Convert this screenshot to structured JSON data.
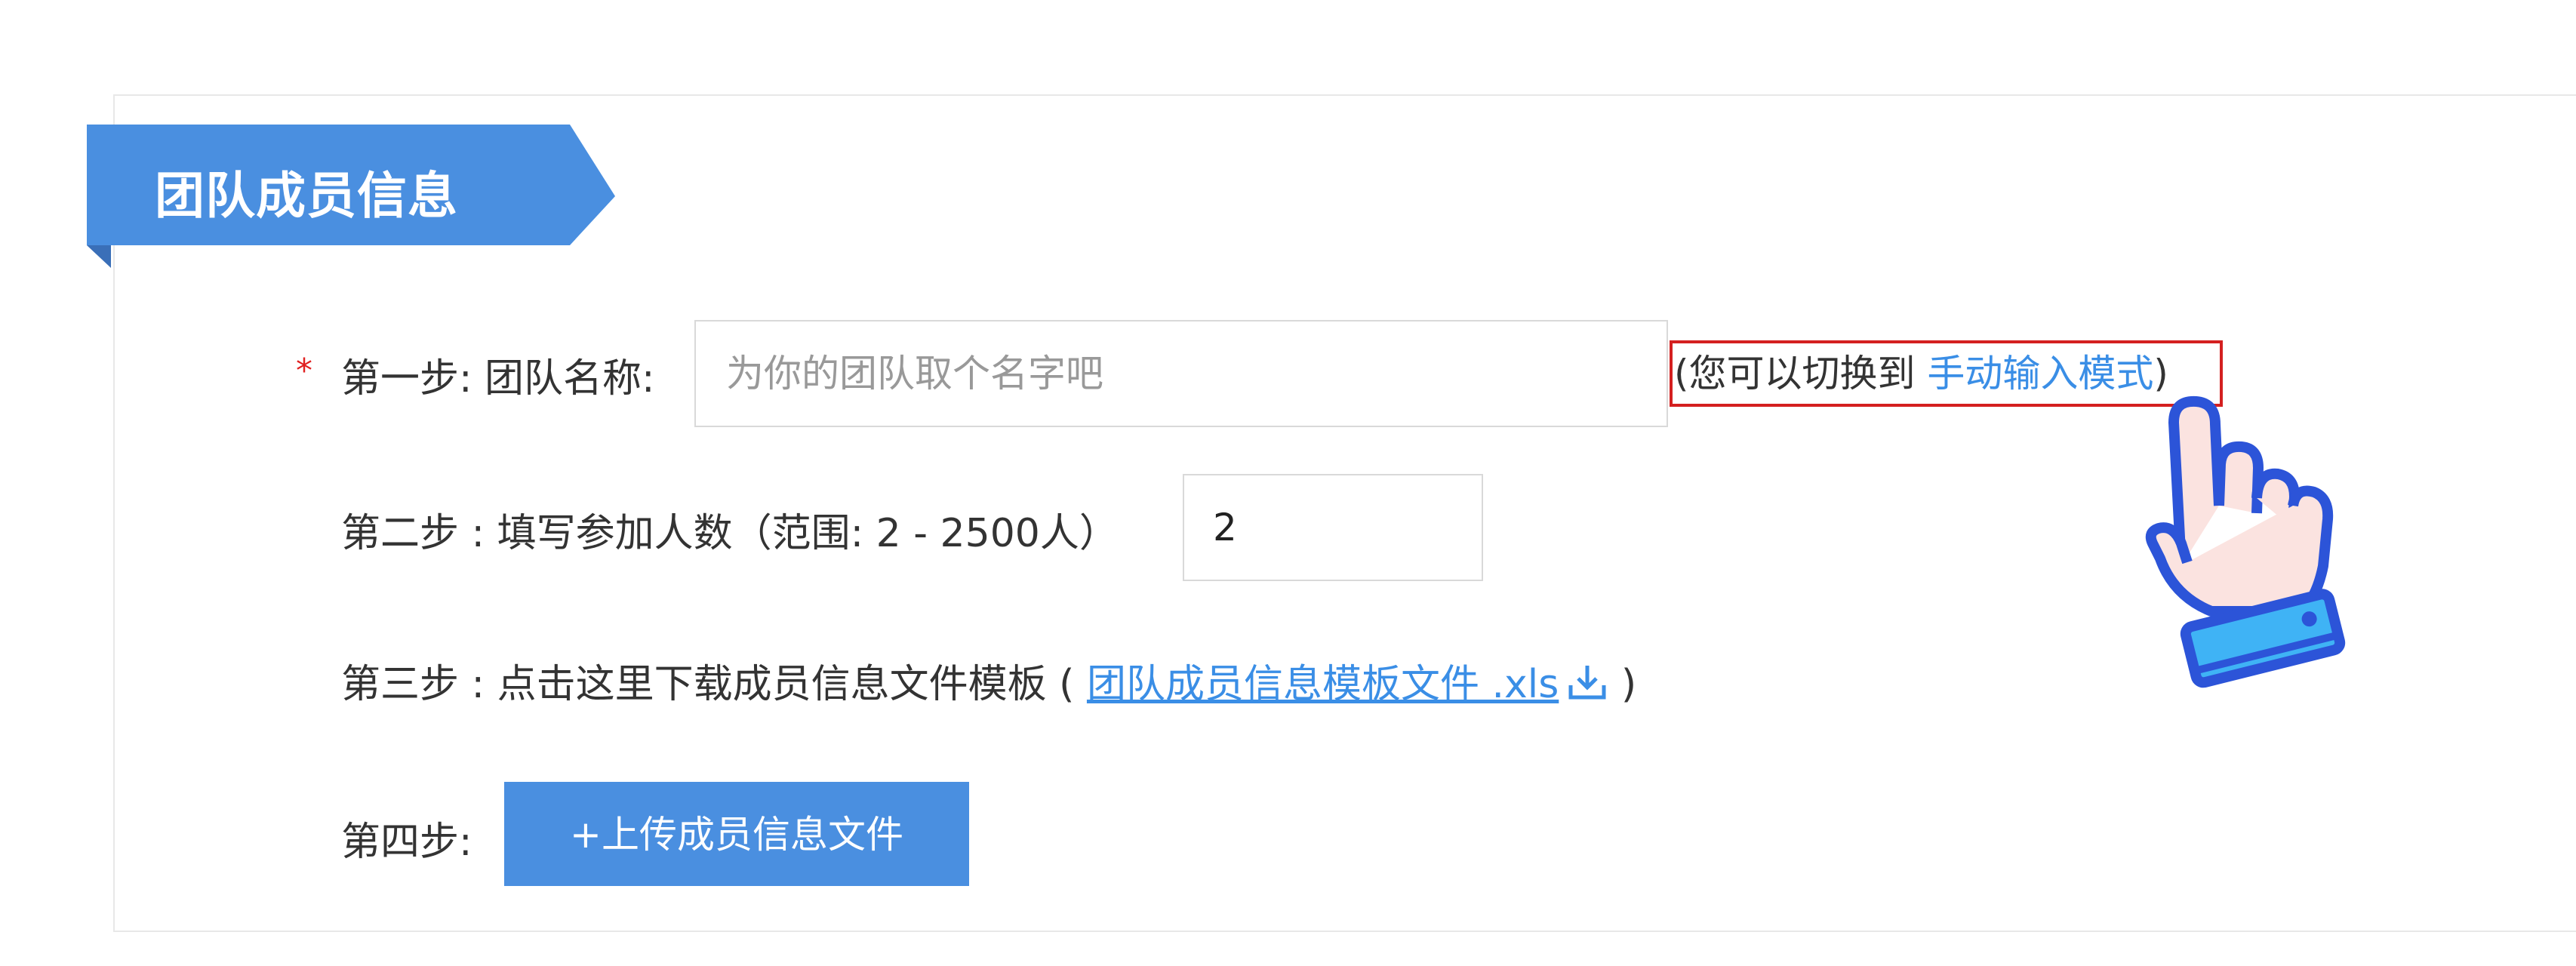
{
  "section": {
    "title": "团队成员信息"
  },
  "step1": {
    "label": "第一步: 团队名称:",
    "required_mark": "*",
    "input_placeholder": "为你的团队取个名字吧",
    "input_value": "",
    "hint_prefix": "(您可以切换到 ",
    "hint_link": "手动输入模式",
    "hint_suffix": ")"
  },
  "step2": {
    "label": "第二步 : 填写参加人数（范围: 2 - 2500人）",
    "input_value": "2"
  },
  "step3": {
    "label_prefix": "第三步 : 点击这里下载成员信息文件模板 ( ",
    "link_text": "团队成员信息模板文件 .xls",
    "label_suffix": " )"
  },
  "step4": {
    "label": "第四步:",
    "button_label": "+上传成员信息文件"
  },
  "icons": {
    "download": "download-icon",
    "hand_pointer": "hand-pointer-icon"
  },
  "colors": {
    "accent_blue": "#4a8fe0",
    "link_blue": "#3a8ee6",
    "required_red": "#e02020",
    "highlight_box_red": "#d42020",
    "hand_outline": "#2c54d8",
    "hand_fill": "#fbe3e0",
    "cuff_fill": "#3fb3f5"
  }
}
